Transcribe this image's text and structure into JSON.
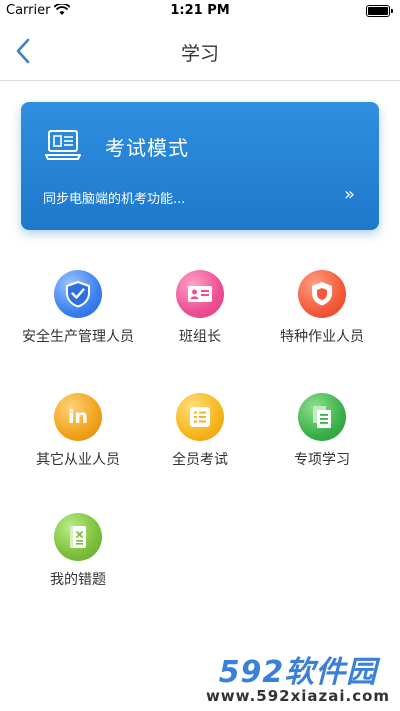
{
  "status_bar": {
    "carrier": "Carrier",
    "time": "1:21 PM"
  },
  "navbar": {
    "title": "学习"
  },
  "exam_card": {
    "title": "考试模式",
    "description": "同步电脑端的机考功能...",
    "arrow": "»",
    "color": "#1e78cc"
  },
  "grid": [
    {
      "label": "安全生产管理人员",
      "icon": "shield-check-icon",
      "color": "#3b7ff0"
    },
    {
      "label": "班组长",
      "icon": "id-card-icon",
      "color": "#ee4f94"
    },
    {
      "label": "特种作业人员",
      "icon": "shield-badge-icon",
      "color": "#f25a3a"
    },
    {
      "label": "其它从业人员",
      "icon": "linkedin-icon",
      "color": "#f0a21c"
    },
    {
      "label": "全员考试",
      "icon": "checklist-icon",
      "color": "#f6b51c"
    },
    {
      "label": "专项学习",
      "icon": "documents-icon",
      "color": "#3bb04a"
    },
    {
      "label": "我的错题",
      "icon": "notebook-icon",
      "color": "#7bbf3a"
    }
  ],
  "watermark": {
    "logo": "592软件园",
    "url": "www.592xiazai.com"
  }
}
